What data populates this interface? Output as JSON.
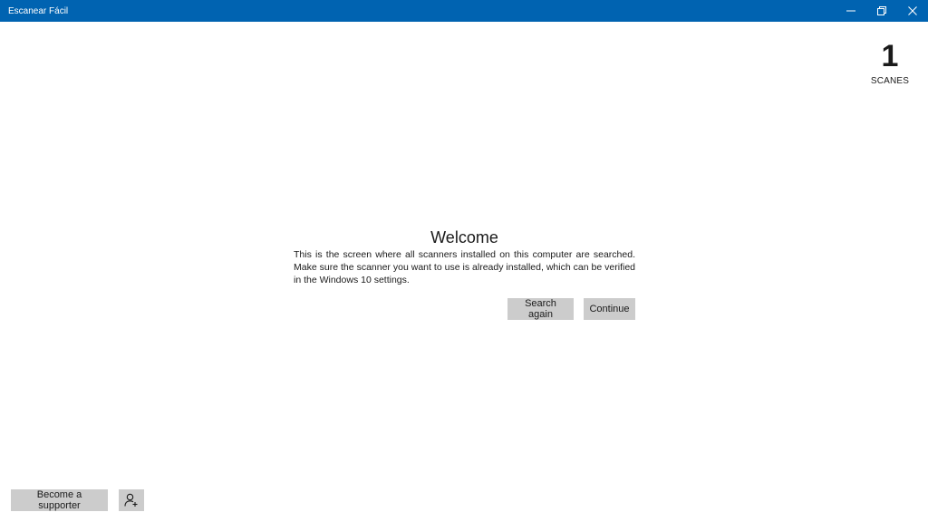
{
  "window": {
    "title": "Escanear Fácil",
    "controls": {
      "minimize_icon": "minimize-icon",
      "restore_icon": "restore-icon",
      "close_icon": "close-icon"
    },
    "accent_color": "#0063b1"
  },
  "counter": {
    "value": "1",
    "label": "SCANES"
  },
  "welcome": {
    "title": "Welcome",
    "message": "This is the screen where all scanners installed on this computer are searched. Make sure the scanner you want to use is already installed, which can be verified in the Windows 10 settings.",
    "search_again_label": "Search again",
    "continue_label": "Continue"
  },
  "footer": {
    "supporter_label": "Become a supporter",
    "account_icon": "add-person-icon"
  }
}
